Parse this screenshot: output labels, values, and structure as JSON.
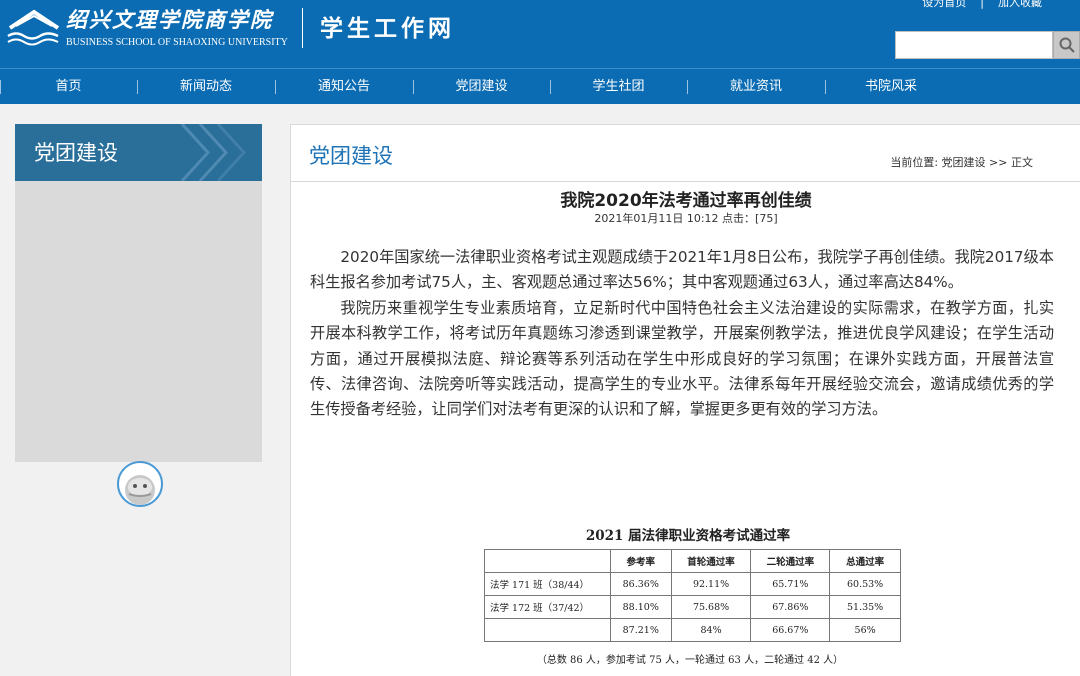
{
  "header": {
    "logo_text": "绍兴文理学院商学院",
    "logo_subtitle": "BUSINESS SCHOOL OF SHAOXING UNIVERSITY",
    "site_name": "学生工作网",
    "links": [
      "设为首页",
      "加入收藏"
    ],
    "search": {
      "placeholder": "",
      "value": ""
    }
  },
  "nav": [
    "首页",
    "新闻动态",
    "通知公告",
    "党团建设",
    "学生社团",
    "就业资讯",
    "书院风采"
  ],
  "sidebar": {
    "title": "党团建设"
  },
  "main": {
    "section_title": "党团建设",
    "breadcrumb": "当前位置: 党团建设 >> 正文",
    "article": {
      "title": "我院2020年法考通过率再创佳绩",
      "meta": "2021年01月11日 10:12  点击：[75]",
      "paragraphs": [
        "2020年国家统一法律职业资格考试主观题成绩于2021年1月8日公布，我院学子再创佳绩。我院2017级本科生报名参加考试75人，主、客观题总通过率达56%；其中客观题通过63人，通过率高达84%。",
        "我院历来重视学生专业素质培育，立足新时代中国特色社会主义法治建设的实际需求，在教学方面，扎实开展本科教学工作，将考试历年真题练习渗透到课堂教学，开展案例教学法，推进优良学风建设；在学生活动方面，通过开展模拟法庭、辩论赛等系列活动在学生中形成良好的学习氛围；在课外实践方面，开展普法宣传、法律咨询、法院旁听等实践活动，提高学生的专业水平。法律系每年开展经验交流会，邀请成绩优秀的学生传授备考经验，让同学们对法考有更深的认识和了解，掌握更多更有效的学习方法。"
      ]
    },
    "figure": {
      "caption": "2021 届法律职业资格考试通过率",
      "headers": [
        "",
        "参考率",
        "首轮通过率",
        "二轮通过率",
        "总通过率"
      ],
      "rows": [
        [
          "法学 171 班（38/44）",
          "86.36%",
          "92.11%",
          "65.71%",
          "60.53%"
        ],
        [
          "法学 172 班（37/42）",
          "88.10%",
          "75.68%",
          "67.86%",
          "51.35%"
        ],
        [
          "",
          "87.21%",
          "84%",
          "66.67%",
          "56%"
        ]
      ],
      "note": "（总数 86 人，参加考试 75 人，一轮通过 63 人，二轮通过 42 人）"
    }
  },
  "colors": {
    "brand_blue": "#0b6cb3",
    "sidebar_head": "#2a6e9a",
    "section_title": "#1f74b8",
    "sidebar_body": "#dadada"
  },
  "icons": {
    "logo": "school-logo-icon",
    "search": "magnifier-icon",
    "sidebar_decoration": "double-chevron-icon",
    "mascot": "mascot-avatar-icon"
  }
}
